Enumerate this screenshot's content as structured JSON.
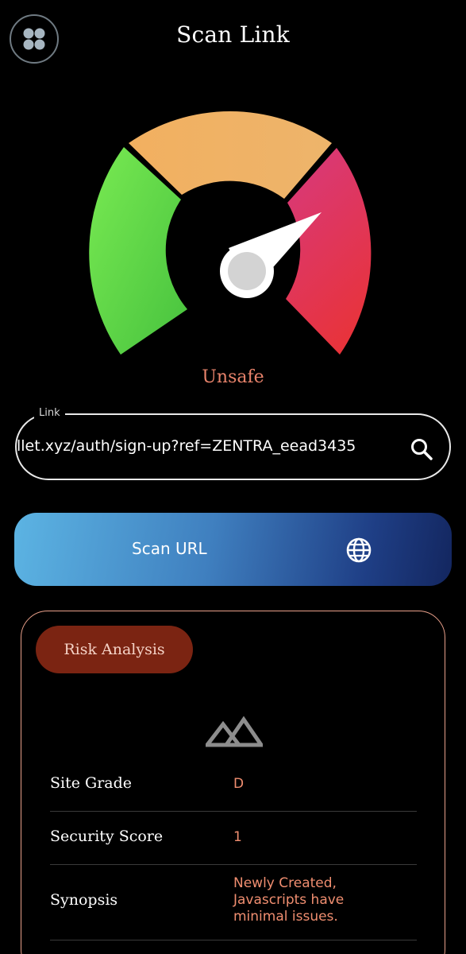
{
  "header": {
    "title": "Scan Link",
    "menu_icon": "grid-menu-icon"
  },
  "gauge": {
    "status": "Unsafe",
    "needle_level": 0.82,
    "segments": [
      {
        "name": "safe",
        "color": "#5fd44b"
      },
      {
        "name": "caution",
        "color": "#f0aa5b"
      },
      {
        "name": "unsafe",
        "color": "#e03a5a"
      }
    ]
  },
  "link_input": {
    "label": "Link",
    "value": "llet.xyz/auth/sign-up?ref=ZENTRA_eead3435",
    "icon": "search-icon"
  },
  "scan_button": {
    "label": "Scan URL",
    "icon": "globe-icon"
  },
  "risk_card": {
    "badge": "Risk Analysis",
    "icon": "mountain-icon",
    "rows": [
      {
        "key": "Site Grade",
        "value": "D"
      },
      {
        "key": "Security Score",
        "value": "1"
      },
      {
        "key": "Synopsis",
        "value": "Newly Created, Javascripts have minimal issues."
      }
    ]
  },
  "colors": {
    "accent": "#e8836b",
    "badge_bg": "#7b2412",
    "card_border": "#e9a08a"
  }
}
